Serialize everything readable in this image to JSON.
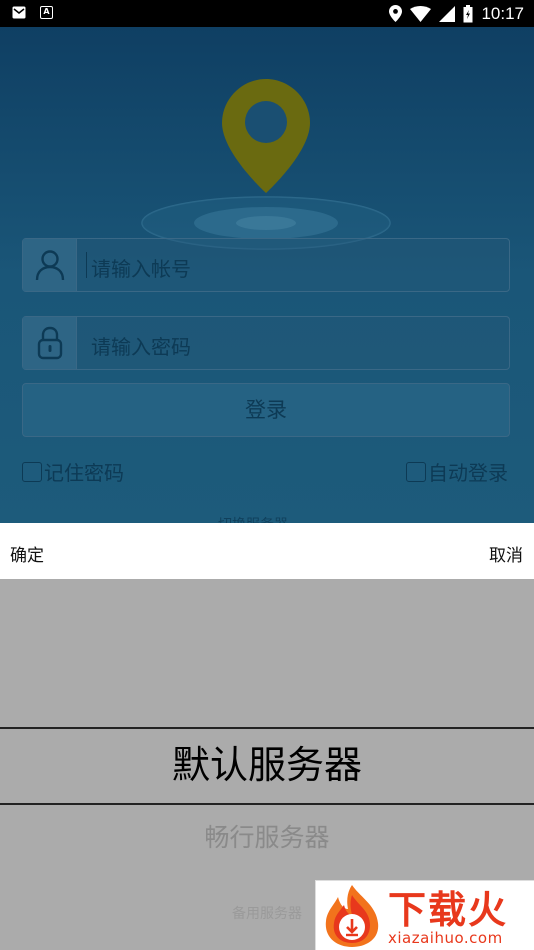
{
  "status_bar": {
    "time": "10:17",
    "left_icons": [
      "mail-notification-icon",
      "text-notification-icon"
    ],
    "notif_glyph_a": "A",
    "right_icons": [
      "location-icon",
      "wifi-icon",
      "cell-signal-icon",
      "battery-icon"
    ]
  },
  "login": {
    "account_placeholder": "请输入帐号",
    "password_placeholder": "请输入密码",
    "login_button": "登录",
    "remember_password": "记住密码",
    "auto_login": "自动登录",
    "peek_text": "切换服务器"
  },
  "picker": {
    "confirm": "确定",
    "cancel": "取消",
    "options": [
      "默认服务器",
      "畅行服务器",
      "备用服务器"
    ],
    "selected_index": 0
  },
  "watermark": {
    "brand": "下载火",
    "domain": "xiazaihuo.com"
  },
  "colors": {
    "brand_red": "#e8381c",
    "pin_yellow": "#6a6a10",
    "bg_dim": "#1a5678",
    "wheel_bg": "#ababab"
  }
}
